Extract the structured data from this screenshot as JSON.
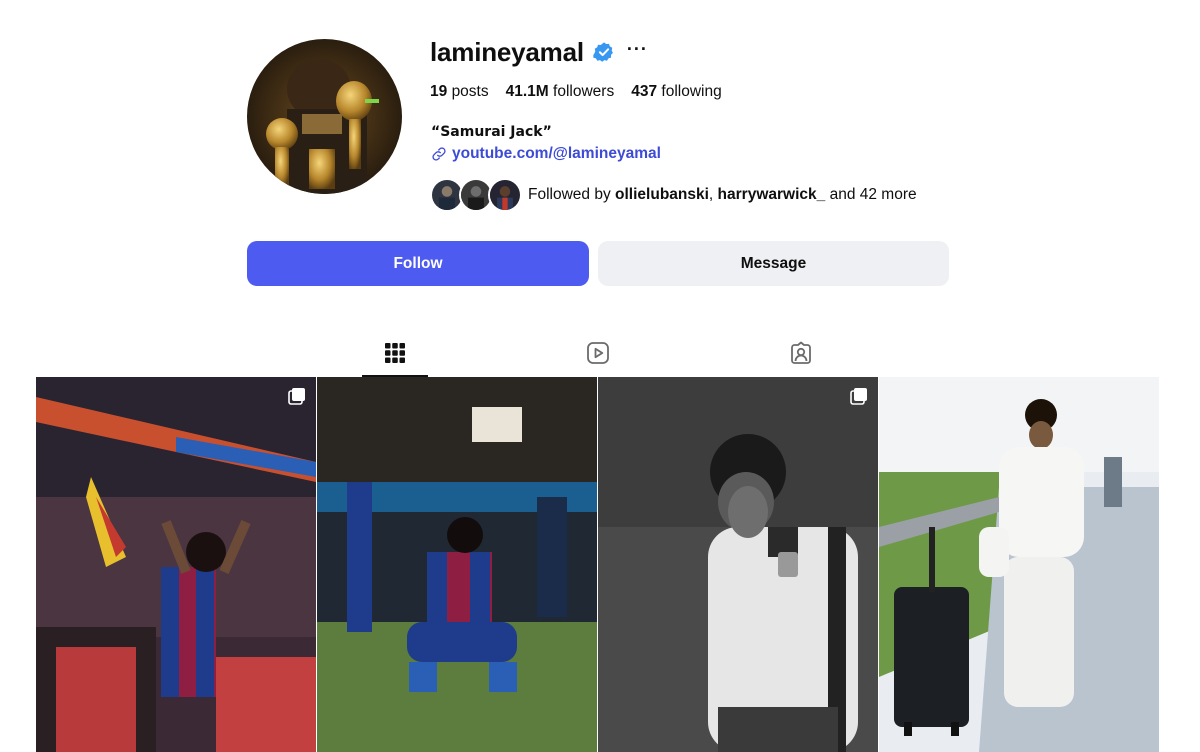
{
  "profile": {
    "username": "lamineyamal",
    "more_label": "···",
    "verified": true,
    "full_name": "“Samurai Jack”",
    "link": "youtube.com/@lamineyamal"
  },
  "stats": {
    "posts_count": "19",
    "posts_label": "posts",
    "followers_count": "41.1M",
    "followers_label": "followers",
    "following_count": "437",
    "following_label": "following"
  },
  "followed_by": {
    "prefix": "Followed by",
    "user1": "ollielubanski",
    "separator": ",",
    "user2": "harrywarwick_",
    "suffix": "and 42 more"
  },
  "actions": {
    "follow_label": "Follow",
    "message_label": "Message"
  },
  "tabs": [
    {
      "icon": "grid-icon",
      "active": true
    },
    {
      "icon": "reels-icon",
      "active": false
    },
    {
      "icon": "tagged-icon",
      "active": false
    }
  ],
  "posts": [
    {
      "icon": "multi-photo-icon",
      "multi": true
    },
    {
      "multi": false
    },
    {
      "icon": "multi-photo-icon",
      "multi": true
    },
    {
      "multi": false
    }
  ],
  "colors": {
    "accent": "#4d5bf0",
    "link": "#3d4bd6",
    "verified": "#3897f0",
    "secondary_button": "#eff0f3"
  }
}
